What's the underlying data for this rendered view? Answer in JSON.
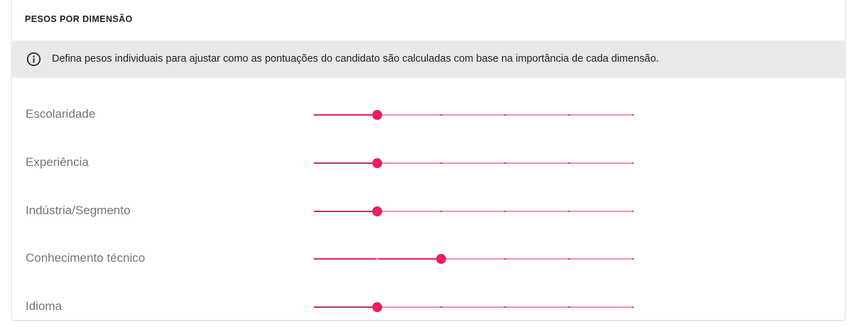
{
  "section": {
    "title": "PESOS POR DIMENSÃO"
  },
  "info": {
    "icon": "info-circle-icon",
    "text": "Defina pesos individuais para ajustar como as pontuações do candidato são calculadas com base na importância de cada dimensão."
  },
  "colors": {
    "accent": "#e91e63",
    "track_inactive": "#f48fb1",
    "info_bg": "#e8e9eb",
    "label": "#757575"
  },
  "slider_scale": {
    "min": 0,
    "max": 5,
    "step": 1
  },
  "dimensions": [
    {
      "label": "Escolaridade",
      "value": 1
    },
    {
      "label": "Experiência",
      "value": 1
    },
    {
      "label": "Indústria/Segmento",
      "value": 1
    },
    {
      "label": "Conhecimento técnico",
      "value": 2
    },
    {
      "label": "Idioma",
      "value": 1
    }
  ]
}
